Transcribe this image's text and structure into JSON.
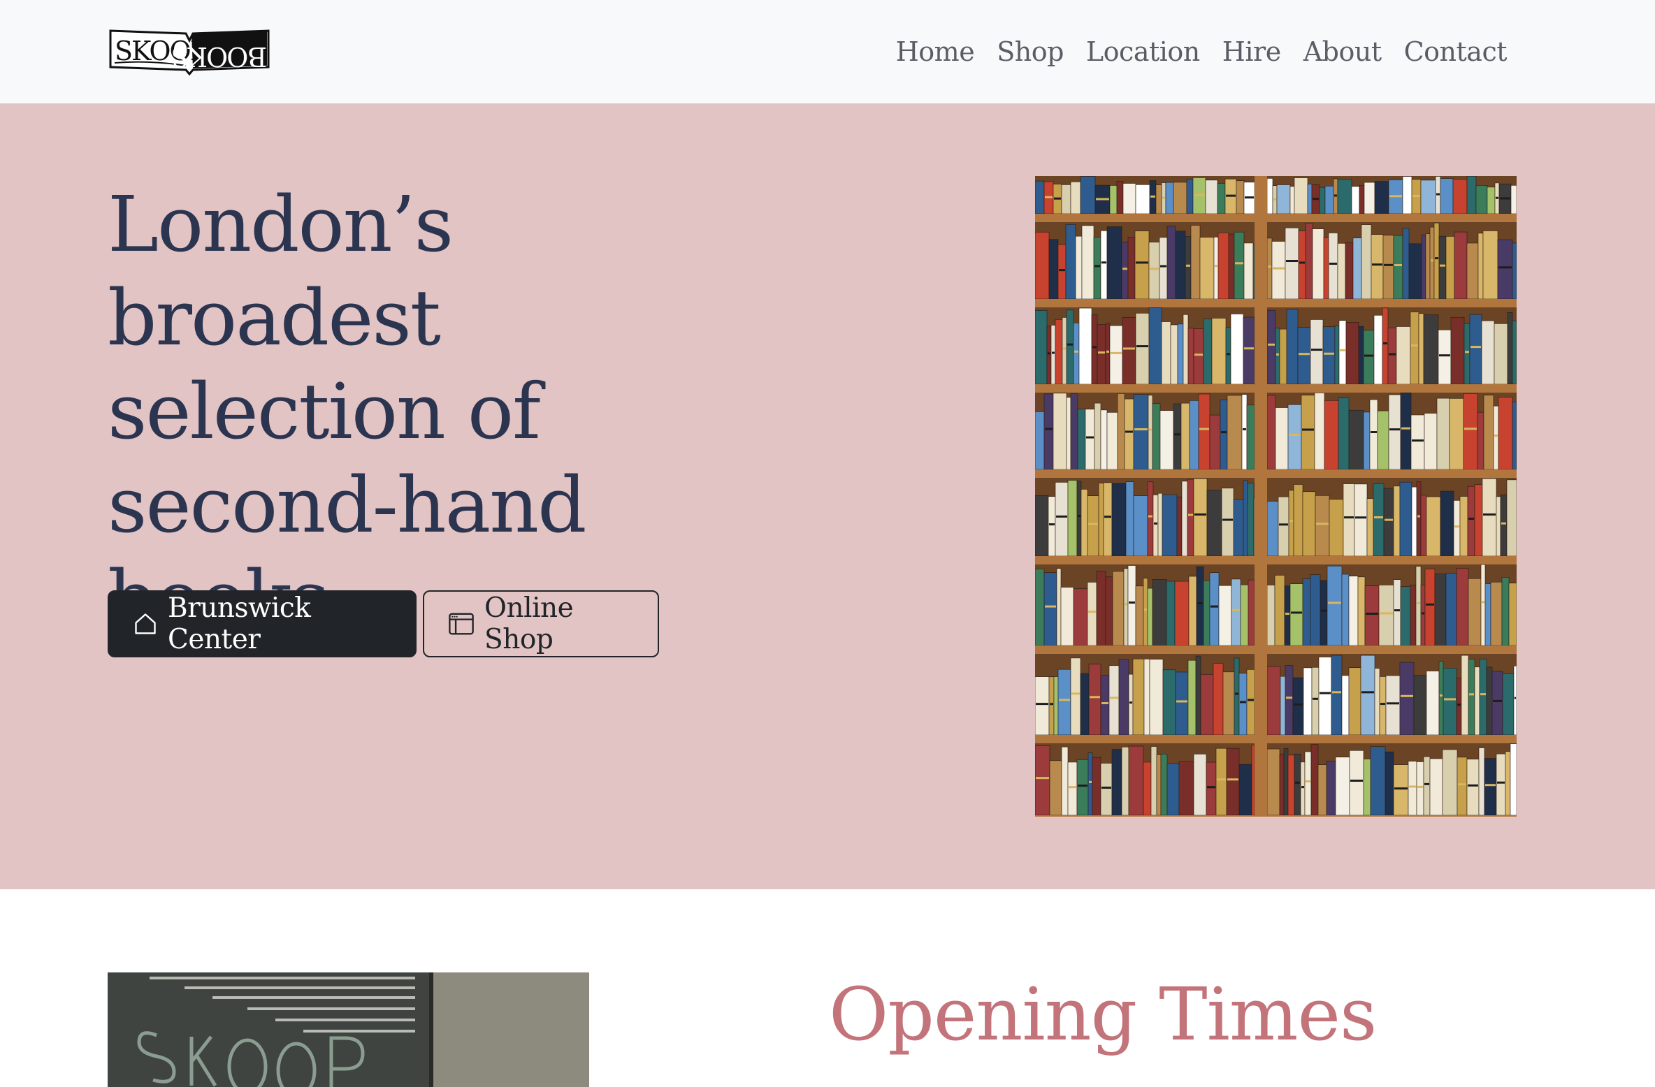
{
  "nav": {
    "logo_text": "SKOOBBOOKS",
    "links": [
      "Home",
      "Shop",
      "Location",
      "Hire",
      "About",
      "Contact"
    ]
  },
  "hero": {
    "title_lines": [
      "London’s broadest",
      "selection of",
      "second-hand",
      "books."
    ],
    "buttons": {
      "primary": {
        "label": "Brunswick Center",
        "icon": "house-icon"
      },
      "secondary": {
        "label": "Online Shop",
        "icon": "browser-window-icon"
      }
    },
    "image_alt": "bookshelves-photo"
  },
  "opening": {
    "title": "Opening Times"
  },
  "colors": {
    "hero_bg": "#e3c4c5",
    "title_text": "#2c3550",
    "accent": "#c2747a",
    "dark_button": "#212529",
    "navbar_bg": "#f8f9fa"
  }
}
